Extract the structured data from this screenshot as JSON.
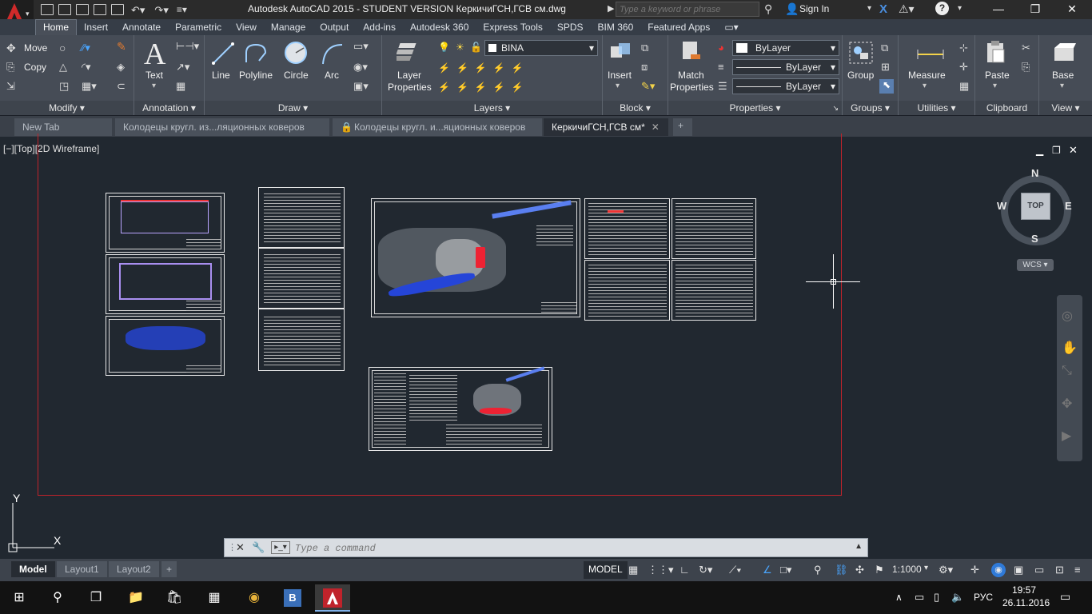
{
  "titlebar": {
    "title": "Autodesk AutoCAD 2015 - STUDENT VERSION    КеркичиГСН,ГСВ см.dwg",
    "search_placeholder": "Type a keyword or phrase",
    "signin": "Sign In"
  },
  "ribbon_tabs": [
    "Home",
    "Insert",
    "Annotate",
    "Parametric",
    "View",
    "Manage",
    "Output",
    "Add-ins",
    "Autodesk 360",
    "Express Tools",
    "SPDS",
    "BIM 360",
    "Featured Apps"
  ],
  "ribbon": {
    "modify": {
      "title": "Modify",
      "move": "Move",
      "copy": "Copy"
    },
    "annotation": {
      "title": "Annotation",
      "text": "Text"
    },
    "draw": {
      "title": "Draw",
      "line": "Line",
      "polyline": "Polyline",
      "circle": "Circle",
      "arc": "Arc"
    },
    "layers": {
      "title": "Layers",
      "layer_properties_1": "Layer",
      "layer_properties_2": "Properties",
      "current_layer": "BINA"
    },
    "block": {
      "title": "Block",
      "insert": "Insert"
    },
    "properties": {
      "title": "Properties",
      "match_1": "Match",
      "match_2": "Properties",
      "color": "ByLayer",
      "linetype": "ByLayer",
      "lineweight": "ByLayer"
    },
    "groups": {
      "title": "Groups",
      "group": "Group"
    },
    "utilities": {
      "title": "Utilities",
      "measure": "Measure"
    },
    "clipboard": {
      "title": "Clipboard",
      "paste": "Paste"
    },
    "view": {
      "title": "View",
      "base": "Base"
    }
  },
  "file_tabs": [
    {
      "label": "New Tab"
    },
    {
      "label": "Колодецы кругл. из...ляционных коверов"
    },
    {
      "label": "Колодецы кругл. и...яционных коверов"
    },
    {
      "label": "КеркичиГСН,ГСВ см*"
    }
  ],
  "canvas": {
    "view_label": "[−][Top][2D Wireframe]",
    "viewcube": {
      "n": "N",
      "s": "S",
      "e": "E",
      "w": "W",
      "top": "TOP",
      "wcs": "WCS"
    },
    "ucs": {
      "x": "X",
      "y": "Y"
    }
  },
  "command": {
    "placeholder": "Type a command"
  },
  "layout_tabs": [
    "Model",
    "Layout1",
    "Layout2"
  ],
  "statusbar": {
    "model": "MODEL",
    "scale": "1:1000"
  },
  "taskbar": {
    "lang": "РУС",
    "time": "19:57",
    "date": "26.11.2016"
  },
  "colors": {
    "accent_red": "#c0232b",
    "canvas_bg": "#212830",
    "ribbon_bg": "#464c56"
  }
}
